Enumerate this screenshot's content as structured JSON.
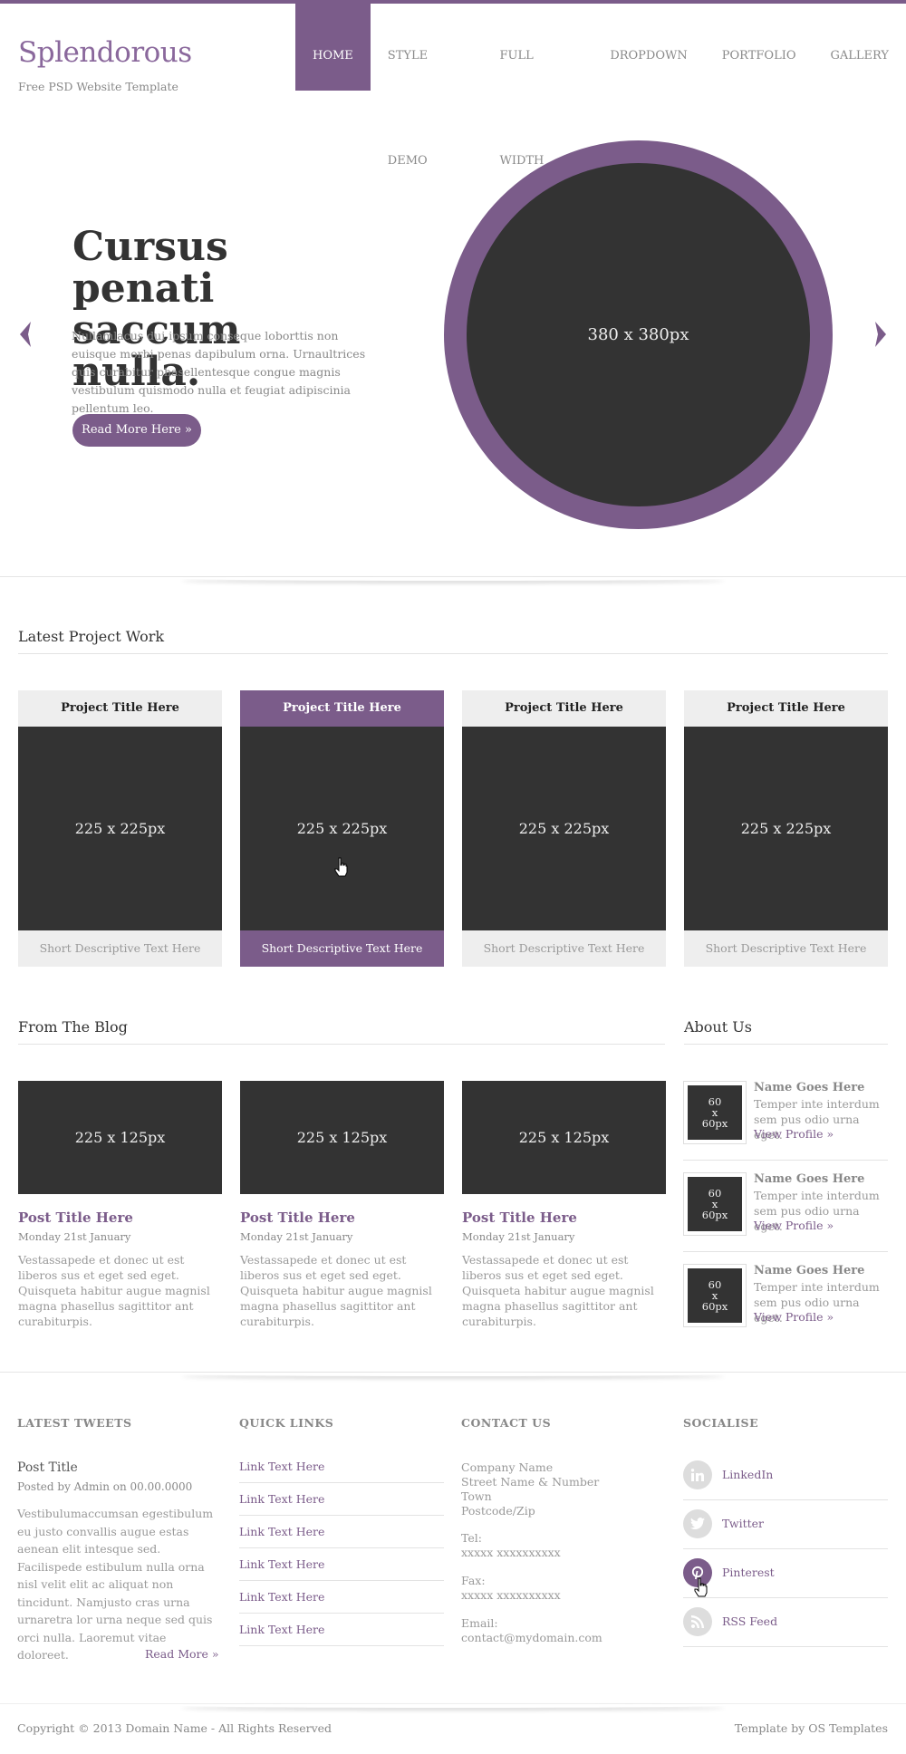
{
  "brand": {
    "logo": "Splendorous",
    "tagline": "Free PSD Website Template",
    "accent_color": "#7b5c8a"
  },
  "nav": {
    "items": [
      "HOME",
      "STYLE DEMO",
      "FULL WIDTH",
      "DROPDOWN",
      "PORTFOLIO",
      "GALLERY"
    ],
    "active": "HOME"
  },
  "hero": {
    "title": "Cursus penati saccum nulla.",
    "text": "Nullamlacus dui ipsum conseque loborttis non euisque morbi penas dapibulum orna. Urnaultrices quis curabitur phasellentesque congue magnis vestibulum quismodo nulla et feugiat adipiscinia pellentum leo.",
    "button": "Read More Here »",
    "image_label": "380 x 380px",
    "prev_icon": "chevron-left-icon",
    "next_icon": "chevron-right-icon"
  },
  "projects": {
    "title": "Latest Project Work",
    "items": [
      {
        "title": "Project Title Here",
        "image": "225 x 225px",
        "caption": "Short Descriptive Text Here"
      },
      {
        "title": "Project Title Here",
        "image": "225 x 225px",
        "caption": "Short Descriptive Text Here"
      },
      {
        "title": "Project Title Here",
        "image": "225 x 225px",
        "caption": "Short Descriptive Text Here"
      },
      {
        "title": "Project Title Here",
        "image": "225 x 225px",
        "caption": "Short Descriptive Text Here"
      }
    ]
  },
  "blog": {
    "title": "From The Blog",
    "posts": [
      {
        "image": "225 x 125px",
        "title": "Post Title Here",
        "date": "Monday 21st January",
        "excerpt": "Vestassapede et donec ut est liberos sus et eget sed eget. Quisqueta habitur augue magnisl magna phasellus sagittitor ant curabiturpis."
      },
      {
        "image": "225 x 125px",
        "title": "Post Title Here",
        "date": "Monday 21st January",
        "excerpt": "Vestassapede et donec ut est liberos sus et eget sed eget. Quisqueta habitur augue magnisl magna phasellus sagittitor ant curabiturpis."
      },
      {
        "image": "225 x 125px",
        "title": "Post Title Here",
        "date": "Monday 21st January",
        "excerpt": "Vestassapede et donec ut est liberos sus et eget sed eget. Quisqueta habitur augue magnisl magna phasellus sagittitor ant curabiturpis."
      }
    ]
  },
  "about": {
    "title": "About Us",
    "people": [
      {
        "thumb_line1": "60",
        "thumb_line2": "x",
        "thumb_line3": "60px",
        "name": "Name Goes Here",
        "text": "Temper inte interdum sem pus odio urna eget.",
        "link": "View Profile »"
      },
      {
        "thumb_line1": "60",
        "thumb_line2": "x",
        "thumb_line3": "60px",
        "name": "Name Goes Here",
        "text": "Temper inte interdum sem pus odio urna eget.",
        "link": "View Profile »"
      },
      {
        "thumb_line1": "60",
        "thumb_line2": "x",
        "thumb_line3": "60px",
        "name": "Name Goes Here",
        "text": "Temper inte interdum sem pus odio urna eget.",
        "link": "View Profile »"
      }
    ]
  },
  "footer": {
    "tweets": {
      "title": "LATEST TWEETS",
      "post_title": "Post Title",
      "meta": "Posted by Admin on 00.00.0000",
      "text": "Vestibulumaccumsan egestibulum eu justo convallis augue estas aenean elit intesque sed. Facilispede estibulum nulla orna nisl velit elit ac aliquat non tincidunt. Namjusto cras urna urnaretra lor urna neque sed quis orci nulla. Laoremut vitae doloreet.",
      "more": "Read More »"
    },
    "quick_links": {
      "title": "QUICK LINKS",
      "links": [
        "Link Text Here",
        "Link Text Here",
        "Link Text Here",
        "Link Text Here",
        "Link Text Here",
        "Link Text Here"
      ]
    },
    "contact": {
      "title": "CONTACT US",
      "company": "Company Name",
      "street": "Street Name & Number",
      "town": "Town",
      "postcode": "Postcode/Zip",
      "tel_label": "Tel:",
      "tel": "xxxxx xxxxxxxxxx",
      "fax_label": "Fax:",
      "fax": "xxxxx xxxxxxxxxx",
      "email_label": "Email:",
      "email": "contact@mydomain.com"
    },
    "social": {
      "title": "SOCIALISE",
      "items": [
        {
          "label": "LinkedIn",
          "icon": "linkedin-icon"
        },
        {
          "label": "Twitter",
          "icon": "twitter-icon"
        },
        {
          "label": "Pinterest",
          "icon": "pinterest-icon"
        },
        {
          "label": "RSS Feed",
          "icon": "rss-icon"
        }
      ]
    },
    "copyright": "Copyright © 2013 Domain Name - All Rights Reserved",
    "credit": "Template by OS Templates"
  }
}
